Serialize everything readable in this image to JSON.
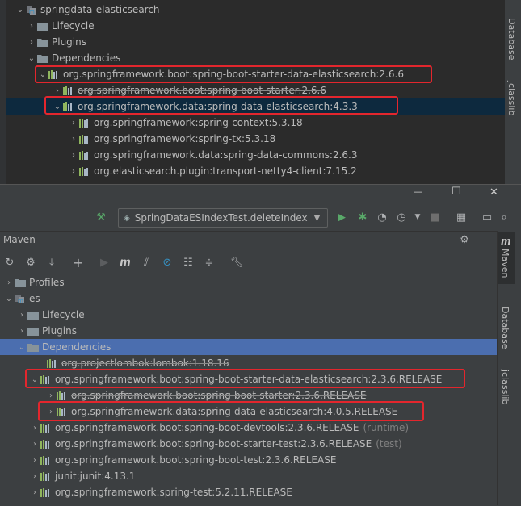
{
  "top_tree": {
    "root": "springdata-elasticsearch",
    "lifecycle": "Lifecycle",
    "plugins": "Plugins",
    "dependencies": "Dependencies",
    "items": [
      "org.springframework.boot:spring-boot-starter-data-elasticsearch:2.6.6",
      "org.springframework.boot:spring-boot-starter:2.6.6",
      "org.springframework.data:spring-data-elasticsearch:4.3.3",
      "org.springframework:spring-context:5.3.18",
      "org.springframework:spring-tx:5.3.18",
      "org.springframework.data:spring-data-commons:2.6.3",
      "org.elasticsearch.plugin:transport-netty4-client:7.15.2"
    ]
  },
  "right_strip_top": {
    "database": "Database",
    "jclasslib": "jclasslib"
  },
  "window": {
    "minimize": "—",
    "maximize": "☐",
    "close": "✕"
  },
  "run_config": {
    "label": "SpringDataESIndexTest.deleteIndex"
  },
  "maven": {
    "title": "Maven",
    "profiles": "Profiles",
    "root": "es",
    "lifecycle": "Lifecycle",
    "plugins": "Plugins",
    "dependencies": "Dependencies",
    "items": [
      {
        "text": "org.projectlombok:lombok:1.18.16",
        "suffix": ""
      },
      {
        "text": "org.springframework.boot:spring-boot-starter-data-elasticsearch:2.3.6.RELEASE",
        "suffix": ""
      },
      {
        "text": "org.springframework.boot:spring-boot-starter:2.3.6.RELEASE",
        "suffix": ""
      },
      {
        "text": "org.springframework.data:spring-data-elasticsearch:4.0.5.RELEASE",
        "suffix": ""
      },
      {
        "text": "org.springframework.boot:spring-boot-devtools:2.3.6.RELEASE",
        "suffix": "(runtime)"
      },
      {
        "text": "org.springframework.boot:spring-boot-starter-test:2.3.6.RELEASE",
        "suffix": "(test)"
      },
      {
        "text": "org.springframework.boot:spring-boot-test:2.3.6.RELEASE",
        "suffix": ""
      },
      {
        "text": "junit:junit:4.13.1",
        "suffix": ""
      },
      {
        "text": "org.springframework:spring-test:5.2.11.RELEASE",
        "suffix": ""
      }
    ]
  },
  "right_strip_bottom": {
    "maven": "Maven",
    "database": "Database",
    "jclasslib": "jclasslib"
  },
  "colors": {
    "bg": "#2b2b2b",
    "panel": "#3c3f41",
    "selected": "#4b6eaf",
    "selected_dark": "#0d293e",
    "red": "#e3262d"
  }
}
